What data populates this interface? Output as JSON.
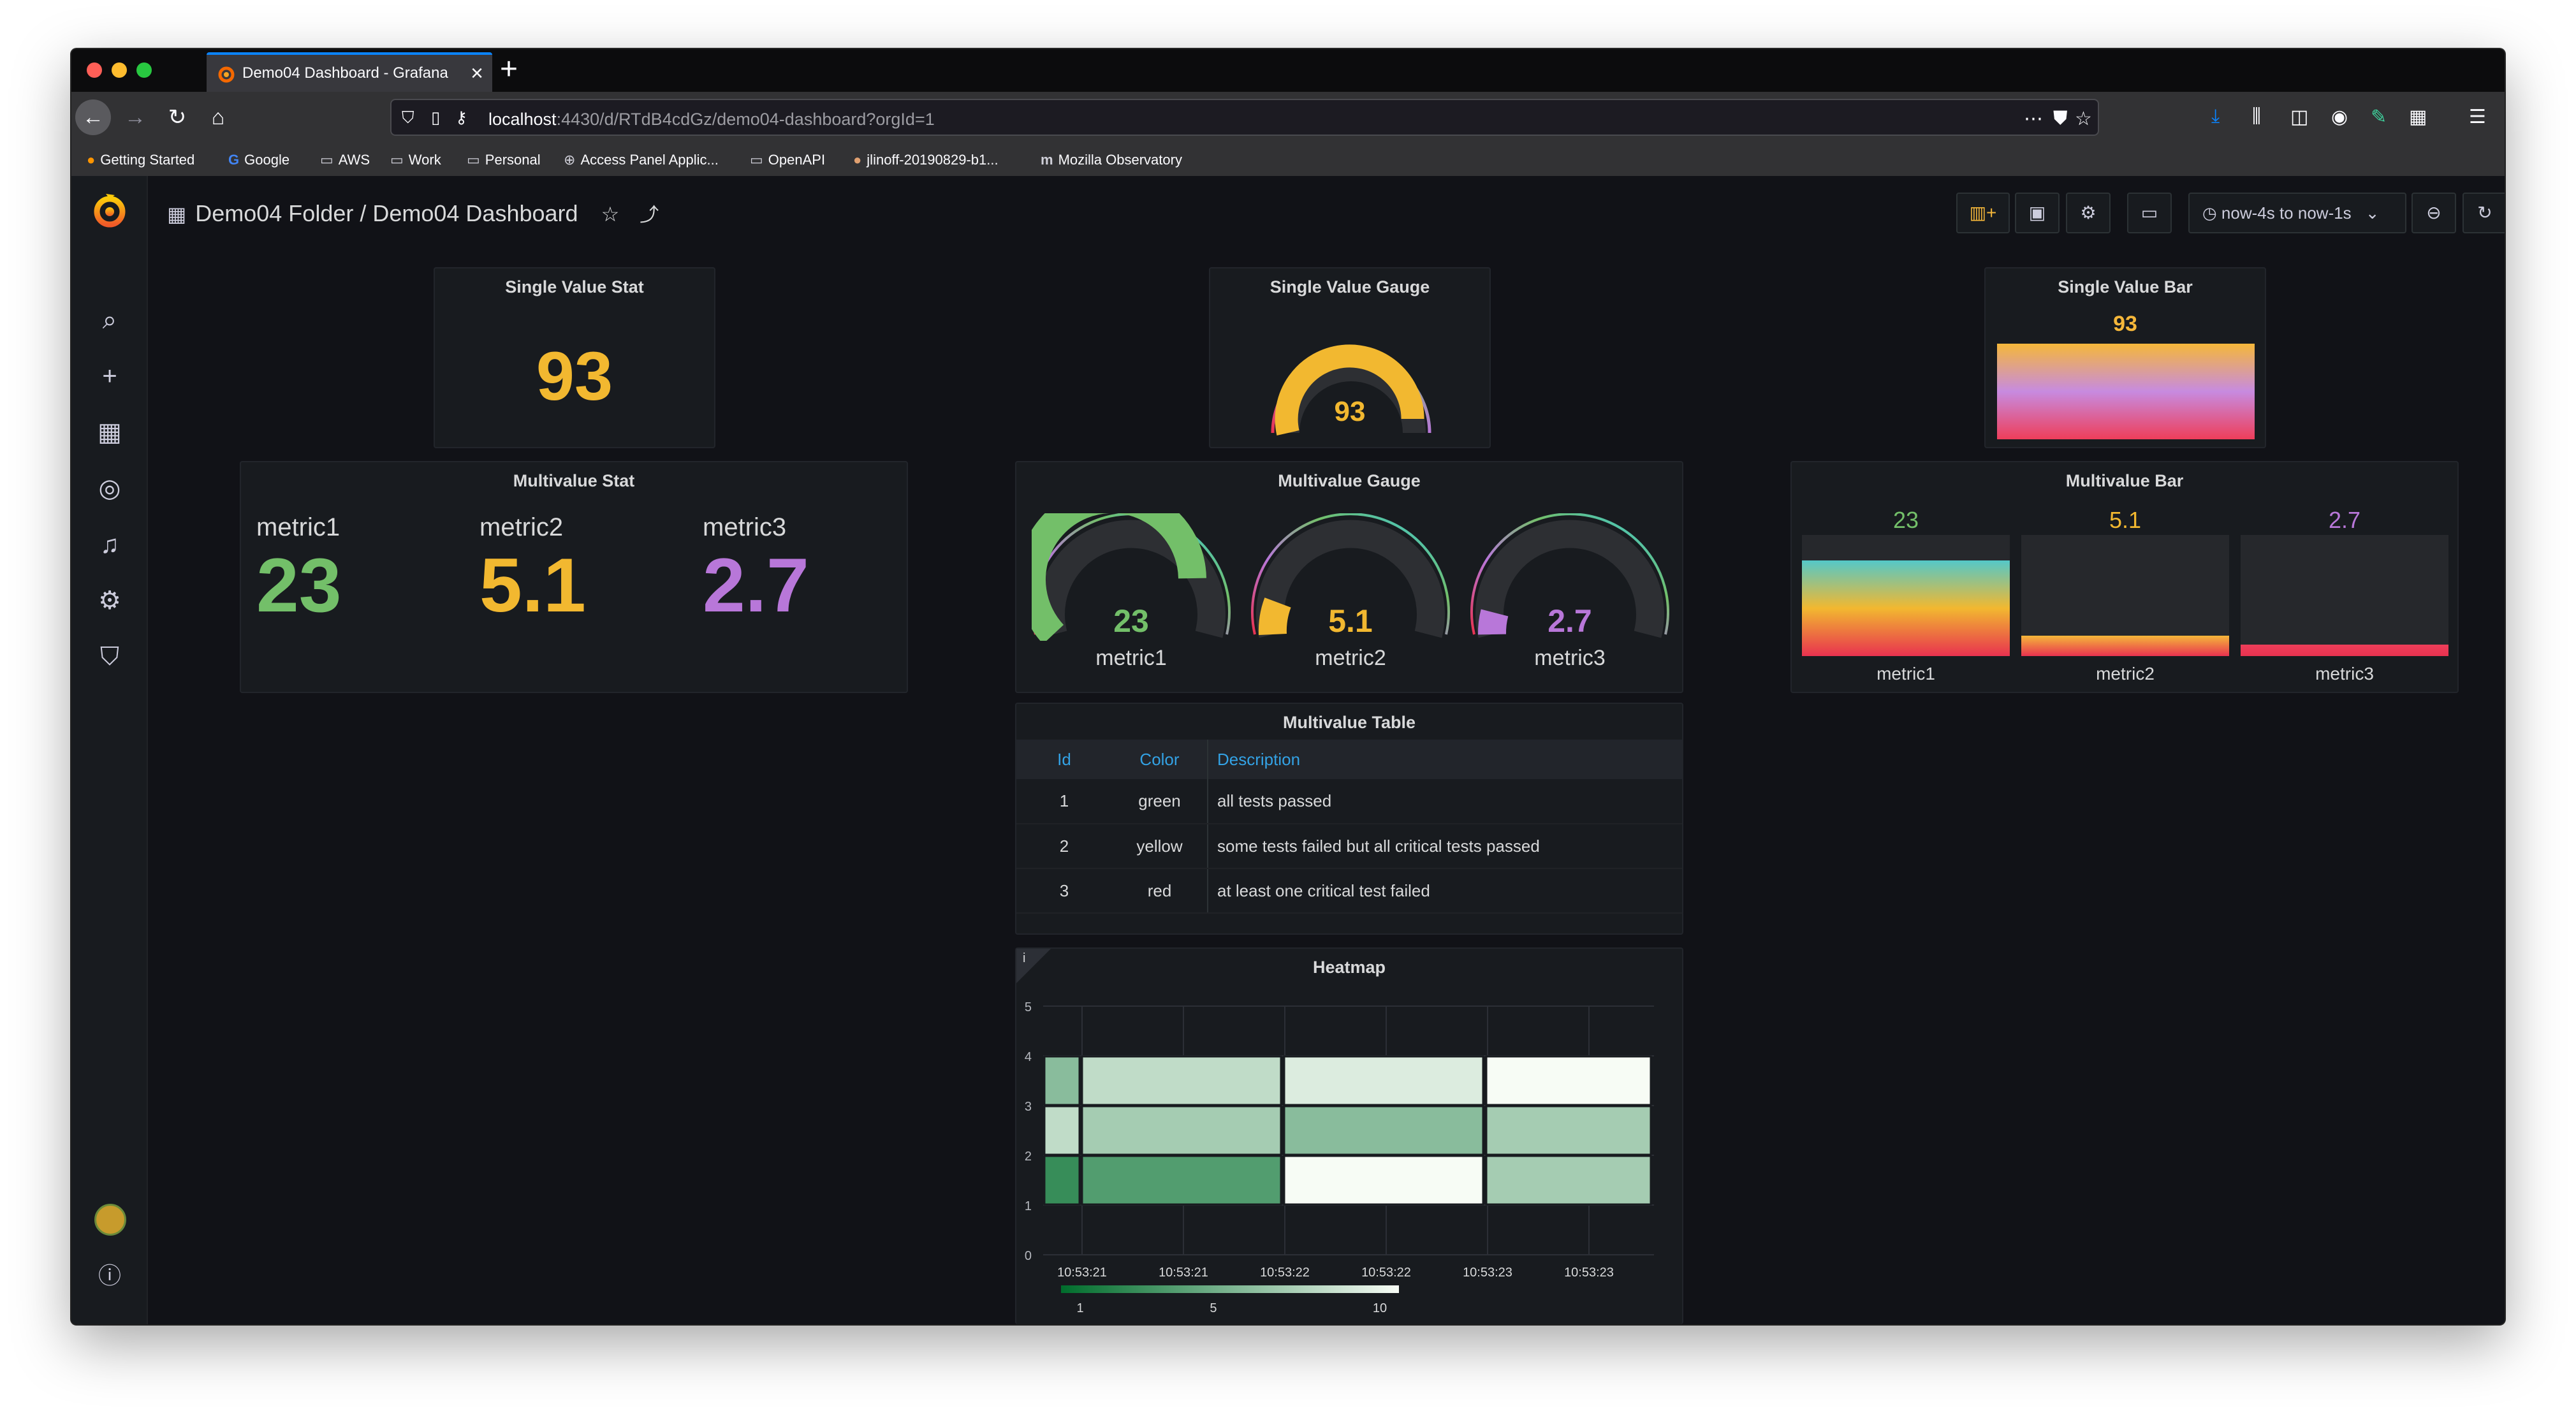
{
  "browser": {
    "tab_title": "Demo04 Dashboard - Grafana",
    "url_host": "localhost",
    "url_rest": ":4430/d/RTdB4cdGz/demo04-dashboard?orgId=1",
    "bookmarks": [
      {
        "label": "Getting Started",
        "icon": "firefox-icon"
      },
      {
        "label": "Google",
        "icon": "google-icon"
      },
      {
        "label": "AWS",
        "icon": "folder-icon"
      },
      {
        "label": "Work",
        "icon": "folder-icon"
      },
      {
        "label": "Personal",
        "icon": "folder-icon"
      },
      {
        "label": "Access Panel Applic...",
        "icon": "globe-icon"
      },
      {
        "label": "OpenAPI",
        "icon": "folder-icon"
      },
      {
        "label": "jlinoff-20190829-b1...",
        "icon": "avatar-icon"
      },
      {
        "label": "Mozilla Observatory",
        "icon": "mozilla-icon"
      }
    ]
  },
  "dashboard": {
    "breadcrumb": "Demo04 Folder / Demo04 Dashboard",
    "time_range": "now-4s to now-1s"
  },
  "panels": {
    "single_stat": {
      "title": "Single Value Stat",
      "value": "93"
    },
    "single_gauge": {
      "title": "Single Value Gauge",
      "value": "93"
    },
    "single_bar": {
      "title": "Single Value Bar",
      "value": "93"
    },
    "multi_stat": {
      "title": "Multivalue Stat",
      "items": [
        {
          "label": "metric1",
          "value": "23"
        },
        {
          "label": "metric2",
          "value": "5.1"
        },
        {
          "label": "metric3",
          "value": "2.7"
        }
      ]
    },
    "multi_gauge": {
      "title": "Multivalue Gauge",
      "items": [
        {
          "label": "metric1",
          "value": "23"
        },
        {
          "label": "metric2",
          "value": "5.1"
        },
        {
          "label": "metric3",
          "value": "2.7"
        }
      ]
    },
    "multi_bar": {
      "title": "Multivalue Bar",
      "items": [
        {
          "label": "metric1",
          "value": "23"
        },
        {
          "label": "metric2",
          "value": "5.1"
        },
        {
          "label": "metric3",
          "value": "2.7"
        }
      ]
    },
    "table": {
      "title": "Multivalue Table",
      "headers": [
        "Id",
        "Color",
        "Description"
      ],
      "rows": [
        [
          "1",
          "green",
          "all tests passed"
        ],
        [
          "2",
          "yellow",
          "some tests failed but all critical tests passed"
        ],
        [
          "3",
          "red",
          "at least one critical test failed"
        ]
      ]
    },
    "heatmap": {
      "title": "Heatmap",
      "info": "i"
    }
  },
  "colors": {
    "green": "#73bf69",
    "yellow": "#f2cc0c",
    "orange": "#f5b73a",
    "purple": "#b877d9",
    "blue": "#33a2e5"
  },
  "chart_data": {
    "type": "heatmap",
    "title": "Heatmap",
    "y_ticks": [
      "0",
      "1",
      "2",
      "3",
      "4",
      "5"
    ],
    "x_ticks": [
      "10:53:21",
      "10:53:21",
      "10:53:22",
      "10:53:22",
      "10:53:23",
      "10:53:23"
    ],
    "y_range": [
      0,
      5
    ],
    "legend_ticks": [
      "1",
      "5",
      "10"
    ],
    "legend_range": [
      1,
      10
    ],
    "cells": [
      {
        "col": 0,
        "row": 3,
        "value": 5
      },
      {
        "col": 0,
        "row": 2,
        "value": 3
      },
      {
        "col": 0,
        "row": 1,
        "value": 8
      },
      {
        "col": 1,
        "row": 3,
        "value": 3
      },
      {
        "col": 1,
        "row": 2,
        "value": 4
      },
      {
        "col": 1,
        "row": 1,
        "value": 7
      },
      {
        "col": 2,
        "row": 3,
        "value": 2
      },
      {
        "col": 2,
        "row": 2,
        "value": 5
      },
      {
        "col": 2,
        "row": 1,
        "value": 1
      },
      {
        "col": 3,
        "row": 3,
        "value": 1
      },
      {
        "col": 3,
        "row": 2,
        "value": 4
      },
      {
        "col": 3,
        "row": 1,
        "value": 4
      }
    ]
  }
}
